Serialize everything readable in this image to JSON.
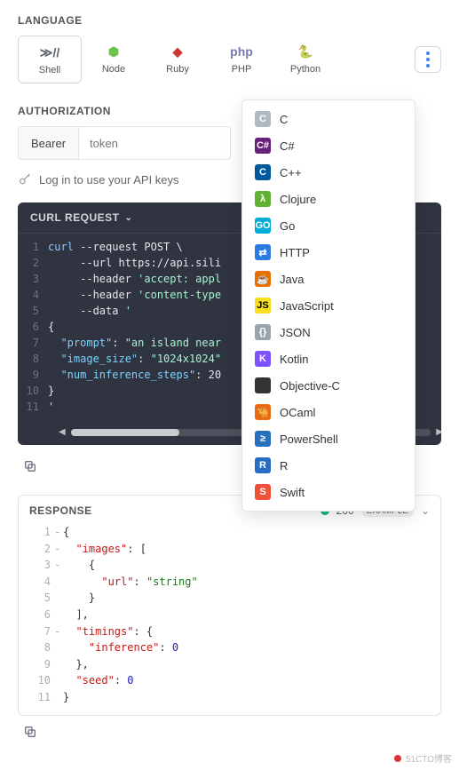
{
  "language": {
    "section_label": "LANGUAGE",
    "tabs": [
      {
        "id": "shell",
        "label": "Shell",
        "color": "#5b6470",
        "glyph": "≫//",
        "selected": true
      },
      {
        "id": "node",
        "label": "Node",
        "color": "#6cc24a",
        "glyph": "⬢"
      },
      {
        "id": "ruby",
        "label": "Ruby",
        "color": "#cc342d",
        "glyph": "◆"
      },
      {
        "id": "php",
        "label": "PHP",
        "color": "#777bb3",
        "glyph": "php"
      },
      {
        "id": "python",
        "label": "Python",
        "color": "#3776ab",
        "glyph": "🐍"
      }
    ],
    "dropdown": [
      {
        "label": "C",
        "bg": "#b0b8c0",
        "glyph": "C"
      },
      {
        "label": "C#",
        "bg": "#68217a",
        "glyph": "C#"
      },
      {
        "label": "C++",
        "bg": "#00599c",
        "glyph": "C"
      },
      {
        "label": "Clojure",
        "bg": "#63b132",
        "glyph": "λ"
      },
      {
        "label": "Go",
        "bg": "#00add8",
        "glyph": "GO"
      },
      {
        "label": "HTTP",
        "bg": "#2a7ae2",
        "glyph": "⇄"
      },
      {
        "label": "Java",
        "bg": "#e76f00",
        "glyph": "☕"
      },
      {
        "label": "JavaScript",
        "bg": "#f7df1e",
        "glyph": "JS",
        "fg": "#000"
      },
      {
        "label": "JSON",
        "bg": "#9aa3ad",
        "glyph": "{}"
      },
      {
        "label": "Kotlin",
        "bg": "#7f52ff",
        "glyph": "K"
      },
      {
        "label": "Objective-C",
        "bg": "#333333",
        "glyph": ""
      },
      {
        "label": "OCaml",
        "bg": "#ec6813",
        "glyph": "🐫"
      },
      {
        "label": "PowerShell",
        "bg": "#2671be",
        "glyph": "≥"
      },
      {
        "label": "R",
        "bg": "#276dc3",
        "glyph": "R"
      },
      {
        "label": "Swift",
        "bg": "#f05138",
        "glyph": "S"
      }
    ]
  },
  "authorization": {
    "section_label": "AUTHORIZATION",
    "scheme": "Bearer",
    "placeholder": "token",
    "login_hint": "Log in to use your API keys"
  },
  "curl": {
    "title": "CURL REQUEST",
    "lines": [
      {
        "n": "1",
        "html": "<span class='tok-cmd'>curl</span> --request POST &#92;"
      },
      {
        "n": "2",
        "html": "     --url https://api.sili"
      },
      {
        "n": "3",
        "html": "     --header <span class='tok-str'>'accept: appl</span>"
      },
      {
        "n": "4",
        "html": "     --header <span class='tok-str'>'content-type</span>"
      },
      {
        "n": "5",
        "html": "     --data <span class='tok-str'>'</span>"
      },
      {
        "n": "6",
        "html": "{"
      },
      {
        "n": "7",
        "html": "  <span class='tok-key'>\"prompt\"</span>: <span class='tok-str'>\"an island near</span>"
      },
      {
        "n": "8",
        "html": "  <span class='tok-key'>\"image_size\"</span>: <span class='tok-str'>\"1024x1024\"</span>"
      },
      {
        "n": "9",
        "html": "  <span class='tok-key'>\"num_inference_steps\"</span>: 20"
      },
      {
        "n": "10",
        "html": "}"
      },
      {
        "n": "11",
        "html": "<span class='tok-str'>'</span>"
      }
    ]
  },
  "response": {
    "title": "RESPONSE",
    "status_code": "200",
    "example_label": "EXAMPLE",
    "lines": [
      {
        "n": "1",
        "dash": true,
        "html": "{"
      },
      {
        "n": "2",
        "dash": true,
        "html": "  <span class='jk'>\"images\"</span>: ["
      },
      {
        "n": "3",
        "dash": true,
        "html": "    {"
      },
      {
        "n": "4",
        "dash": false,
        "html": "      <span class='jk'>\"url\"</span>: <span class='js'>\"string\"</span>"
      },
      {
        "n": "5",
        "dash": false,
        "html": "    }"
      },
      {
        "n": "6",
        "dash": false,
        "html": "  ],"
      },
      {
        "n": "7",
        "dash": true,
        "html": "  <span class='jk'>\"timings\"</span>: {"
      },
      {
        "n": "8",
        "dash": false,
        "html": "    <span class='jk'>\"inference\"</span>: <span class='jn'>0</span>"
      },
      {
        "n": "9",
        "dash": false,
        "html": "  },"
      },
      {
        "n": "10",
        "dash": false,
        "html": "  <span class='jk'>\"seed\"</span>: <span class='jn'>0</span>"
      },
      {
        "n": "11",
        "dash": false,
        "html": "}"
      }
    ]
  },
  "watermark": "51CTO博客"
}
